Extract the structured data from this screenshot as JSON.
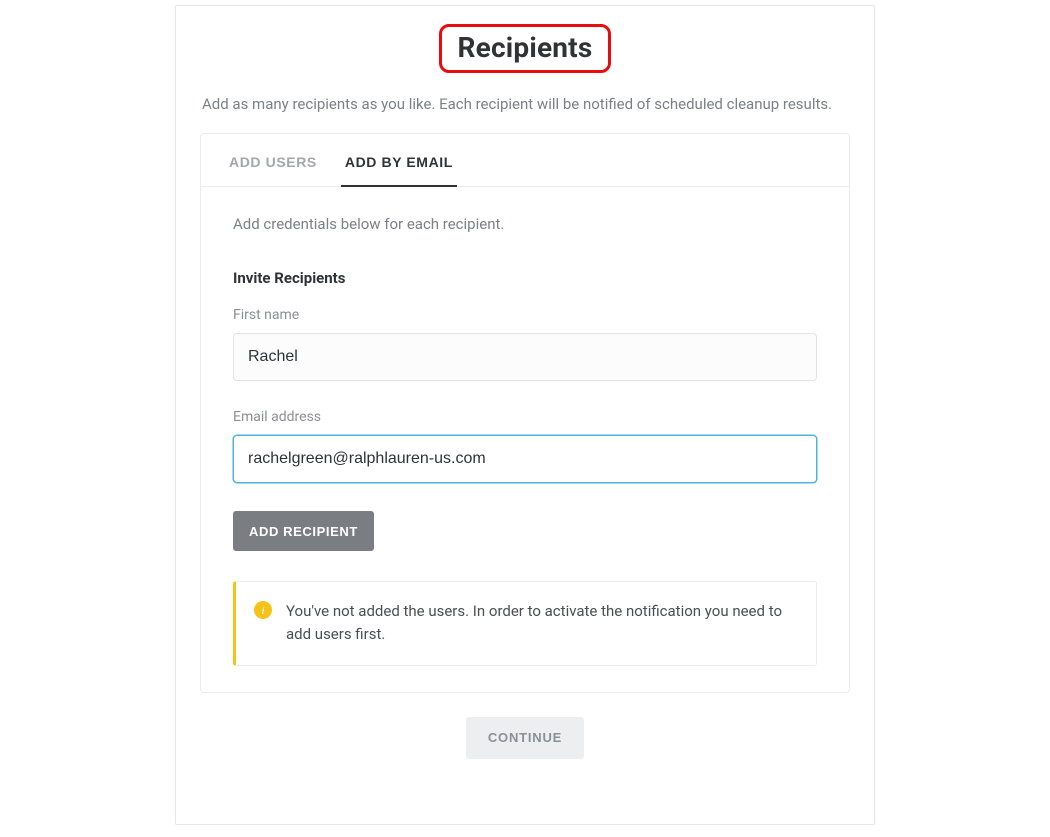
{
  "header": {
    "title": "Recipients",
    "subtitle": "Add as many recipients as you like. Each recipient will be notified of scheduled cleanup results."
  },
  "tabs": {
    "add_users_label": "ADD USERS",
    "add_by_email_label": "ADD BY EMAIL"
  },
  "form": {
    "helper_text": "Add credentials below for each recipient.",
    "section_title": "Invite Recipients",
    "first_name": {
      "label": "First name",
      "value": "Rachel"
    },
    "email": {
      "label": "Email address",
      "value": "rachelgreen@ralphlauren-us.com"
    },
    "add_recipient_label": "ADD RECIPIENT"
  },
  "info": {
    "message": "You've not added the users. In order to activate the notification you need to add users first."
  },
  "footer": {
    "continue_label": "CONTINUE"
  }
}
